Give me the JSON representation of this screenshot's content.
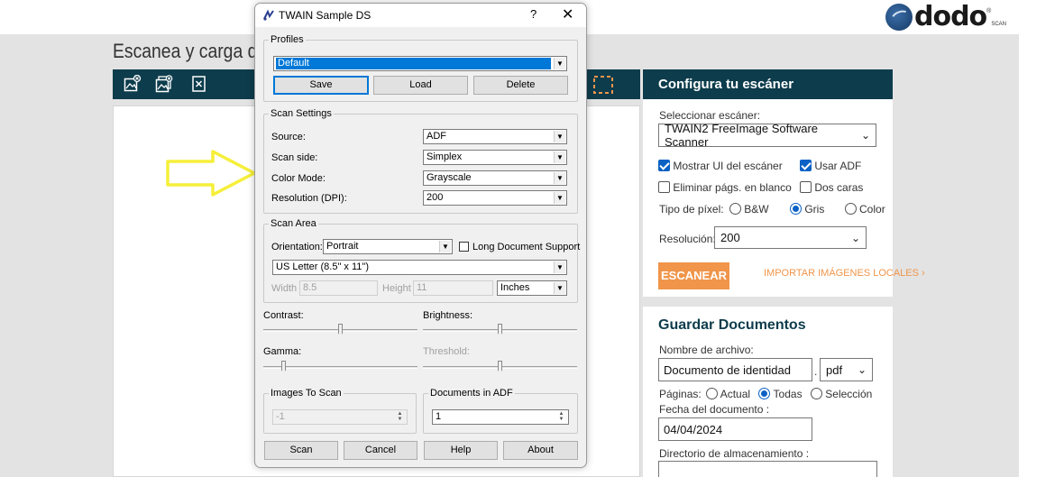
{
  "app": {
    "page_title": "Escanea y carga doc",
    "logo": {
      "word": "dodo",
      "reg": "®",
      "scan": "SCAN"
    }
  },
  "config_panel": {
    "title": "Configura tu escáner",
    "select_scanner_label": "Seleccionar escáner:",
    "scanner_value": "TWAIN2 FreeImage Software Scanner",
    "show_ui_label": "Mostrar UI del escáner",
    "show_ui_checked": true,
    "use_adf_label": "Usar ADF",
    "use_adf_checked": true,
    "remove_blank_label": "Eliminar págs. en blanco",
    "remove_blank_checked": false,
    "duplex_label": "Dos caras",
    "duplex_checked": false,
    "pixel_type_label": "Tipo de píxel:",
    "pixel_options": [
      "B&W",
      "Gris",
      "Color"
    ],
    "pixel_selected": "Gris",
    "resolution_label": "Resolución:",
    "resolution_value": "200",
    "scan_button": "ESCANEAR",
    "import_link": "IMPORTAR IMÁGENES LOCALES ›"
  },
  "save_panel": {
    "title": "Guardar Documentos",
    "filename_label": "Nombre de archivo:",
    "filename_value": "Documento de identidad",
    "dot": ".",
    "format_value": "pdf",
    "pages_label": "Páginas:",
    "pages_options": [
      "Actual",
      "Todas",
      "Selección"
    ],
    "pages_selected": "Todas",
    "date_label": "Fecha del documento :",
    "date_value": "04/04/2024",
    "dir_label": "Directorio de almacenamiento :"
  },
  "dialog": {
    "title": "TWAIN Sample DS",
    "help": "?",
    "close": "✕",
    "profiles": {
      "legend": "Profiles",
      "value": "Default",
      "save": "Save",
      "load": "Load",
      "delete": "Delete"
    },
    "scan_settings": {
      "legend": "Scan Settings",
      "source_label": "Source:",
      "source_value": "ADF",
      "side_label": "Scan side:",
      "side_value": "Simplex",
      "color_label": "Color Mode:",
      "color_value": "Grayscale",
      "res_label": "Resolution (DPI):",
      "res_value": "200"
    },
    "scan_area": {
      "legend": "Scan Area",
      "orientation_label": "Orientation:",
      "orientation_value": "Portrait",
      "long_doc_label": "Long Document Support",
      "long_doc_checked": false,
      "paper_value": "US Letter (8.5\" x 11\")",
      "width_label": "Width",
      "width_value": "8.5",
      "height_label": "Height",
      "height_value": "11",
      "unit_value": "Inches"
    },
    "sliders": {
      "contrast_label": "Contrast:",
      "brightness_label": "Brightness:",
      "gamma_label": "Gamma:",
      "threshold_label": "Threshold:"
    },
    "images_to_scan": {
      "legend": "Images To Scan",
      "value": "-1"
    },
    "docs_in_adf": {
      "legend": "Documents in ADF",
      "value": "1"
    },
    "buttons": {
      "scan": "Scan",
      "cancel": "Cancel",
      "help": "Help",
      "about": "About"
    }
  },
  "colors": {
    "header_teal": "#0d3c4c",
    "accent_orange": "#f0954a",
    "check_blue": "#0b61c4",
    "arrow_yellow": "#f5ef3a"
  }
}
